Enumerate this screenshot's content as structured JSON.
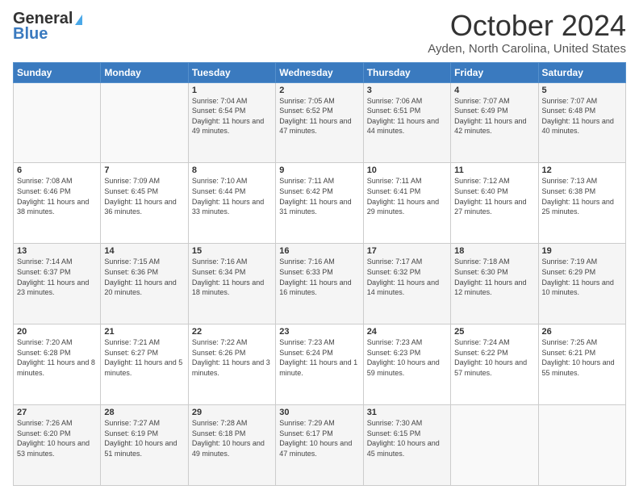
{
  "logo": {
    "line1": "General",
    "line2": "Blue"
  },
  "title": "October 2024",
  "location": "Ayden, North Carolina, United States",
  "days_header": [
    "Sunday",
    "Monday",
    "Tuesday",
    "Wednesday",
    "Thursday",
    "Friday",
    "Saturday"
  ],
  "weeks": [
    [
      {
        "day": "",
        "info": ""
      },
      {
        "day": "",
        "info": ""
      },
      {
        "day": "1",
        "sunrise": "7:04 AM",
        "sunset": "6:54 PM",
        "daylight": "11 hours and 49 minutes."
      },
      {
        "day": "2",
        "sunrise": "7:05 AM",
        "sunset": "6:52 PM",
        "daylight": "11 hours and 47 minutes."
      },
      {
        "day": "3",
        "sunrise": "7:06 AM",
        "sunset": "6:51 PM",
        "daylight": "11 hours and 44 minutes."
      },
      {
        "day": "4",
        "sunrise": "7:07 AM",
        "sunset": "6:49 PM",
        "daylight": "11 hours and 42 minutes."
      },
      {
        "day": "5",
        "sunrise": "7:07 AM",
        "sunset": "6:48 PM",
        "daylight": "11 hours and 40 minutes."
      }
    ],
    [
      {
        "day": "6",
        "sunrise": "7:08 AM",
        "sunset": "6:46 PM",
        "daylight": "11 hours and 38 minutes."
      },
      {
        "day": "7",
        "sunrise": "7:09 AM",
        "sunset": "6:45 PM",
        "daylight": "11 hours and 36 minutes."
      },
      {
        "day": "8",
        "sunrise": "7:10 AM",
        "sunset": "6:44 PM",
        "daylight": "11 hours and 33 minutes."
      },
      {
        "day": "9",
        "sunrise": "7:11 AM",
        "sunset": "6:42 PM",
        "daylight": "11 hours and 31 minutes."
      },
      {
        "day": "10",
        "sunrise": "7:11 AM",
        "sunset": "6:41 PM",
        "daylight": "11 hours and 29 minutes."
      },
      {
        "day": "11",
        "sunrise": "7:12 AM",
        "sunset": "6:40 PM",
        "daylight": "11 hours and 27 minutes."
      },
      {
        "day": "12",
        "sunrise": "7:13 AM",
        "sunset": "6:38 PM",
        "daylight": "11 hours and 25 minutes."
      }
    ],
    [
      {
        "day": "13",
        "sunrise": "7:14 AM",
        "sunset": "6:37 PM",
        "daylight": "11 hours and 23 minutes."
      },
      {
        "day": "14",
        "sunrise": "7:15 AM",
        "sunset": "6:36 PM",
        "daylight": "11 hours and 20 minutes."
      },
      {
        "day": "15",
        "sunrise": "7:16 AM",
        "sunset": "6:34 PM",
        "daylight": "11 hours and 18 minutes."
      },
      {
        "day": "16",
        "sunrise": "7:16 AM",
        "sunset": "6:33 PM",
        "daylight": "11 hours and 16 minutes."
      },
      {
        "day": "17",
        "sunrise": "7:17 AM",
        "sunset": "6:32 PM",
        "daylight": "11 hours and 14 minutes."
      },
      {
        "day": "18",
        "sunrise": "7:18 AM",
        "sunset": "6:30 PM",
        "daylight": "11 hours and 12 minutes."
      },
      {
        "day": "19",
        "sunrise": "7:19 AM",
        "sunset": "6:29 PM",
        "daylight": "11 hours and 10 minutes."
      }
    ],
    [
      {
        "day": "20",
        "sunrise": "7:20 AM",
        "sunset": "6:28 PM",
        "daylight": "11 hours and 8 minutes."
      },
      {
        "day": "21",
        "sunrise": "7:21 AM",
        "sunset": "6:27 PM",
        "daylight": "11 hours and 5 minutes."
      },
      {
        "day": "22",
        "sunrise": "7:22 AM",
        "sunset": "6:26 PM",
        "daylight": "11 hours and 3 minutes."
      },
      {
        "day": "23",
        "sunrise": "7:23 AM",
        "sunset": "6:24 PM",
        "daylight": "11 hours and 1 minute."
      },
      {
        "day": "24",
        "sunrise": "7:23 AM",
        "sunset": "6:23 PM",
        "daylight": "10 hours and 59 minutes."
      },
      {
        "day": "25",
        "sunrise": "7:24 AM",
        "sunset": "6:22 PM",
        "daylight": "10 hours and 57 minutes."
      },
      {
        "day": "26",
        "sunrise": "7:25 AM",
        "sunset": "6:21 PM",
        "daylight": "10 hours and 55 minutes."
      }
    ],
    [
      {
        "day": "27",
        "sunrise": "7:26 AM",
        "sunset": "6:20 PM",
        "daylight": "10 hours and 53 minutes."
      },
      {
        "day": "28",
        "sunrise": "7:27 AM",
        "sunset": "6:19 PM",
        "daylight": "10 hours and 51 minutes."
      },
      {
        "day": "29",
        "sunrise": "7:28 AM",
        "sunset": "6:18 PM",
        "daylight": "10 hours and 49 minutes."
      },
      {
        "day": "30",
        "sunrise": "7:29 AM",
        "sunset": "6:17 PM",
        "daylight": "10 hours and 47 minutes."
      },
      {
        "day": "31",
        "sunrise": "7:30 AM",
        "sunset": "6:15 PM",
        "daylight": "10 hours and 45 minutes."
      },
      {
        "day": "",
        "info": ""
      },
      {
        "day": "",
        "info": ""
      }
    ]
  ]
}
